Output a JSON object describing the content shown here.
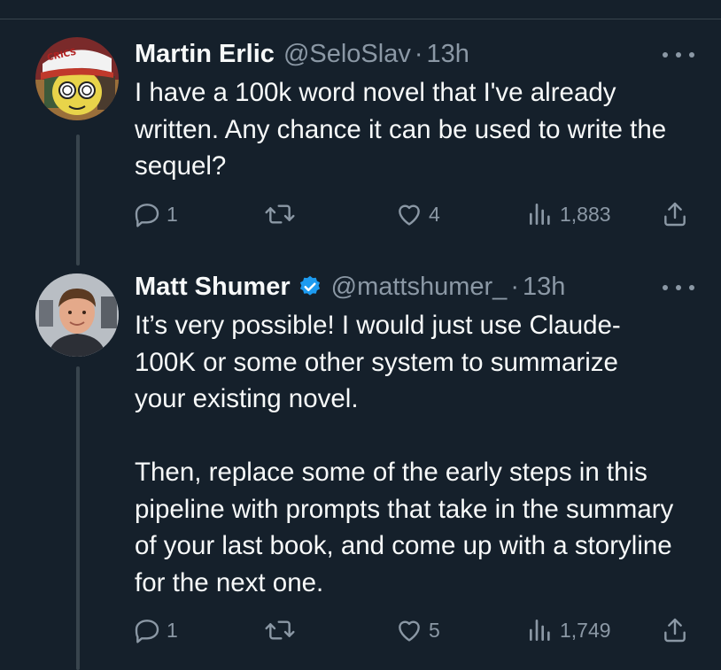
{
  "tweets": [
    {
      "display_name": "Martin Erlic",
      "handle": "@SeloSlav",
      "separator": "·",
      "time": "13h",
      "verified": false,
      "avatar_badge": "CRICS",
      "text": "I have a 100k word novel that I've already written. Any chance it can be used to write the sequel?",
      "replies": "1",
      "likes": "4",
      "views": "1,883"
    },
    {
      "display_name": "Matt Shumer",
      "handle": "@mattshumer_",
      "separator": "·",
      "time": "13h",
      "verified": true,
      "text": "It’s very possible! I would just use Claude-100K or some other system to summarize your existing novel.\n\nThen, replace some of the early steps in this pipeline with prompts that take in the summary of your last book, and come up with a storyline for the next one.",
      "replies": "1",
      "likes": "5",
      "views": "1,749"
    }
  ],
  "icons": {
    "reply": "reply-icon",
    "retweet": "retweet-icon",
    "like": "like-icon",
    "views": "views-icon",
    "share": "share-icon",
    "more": "more-icon",
    "verified": "verified-badge-icon"
  },
  "colors": {
    "background": "#15202b",
    "text": "#f7f9f9",
    "muted": "#8b98a5",
    "verified": "#1d9bf0",
    "thread_line": "#38444d"
  }
}
